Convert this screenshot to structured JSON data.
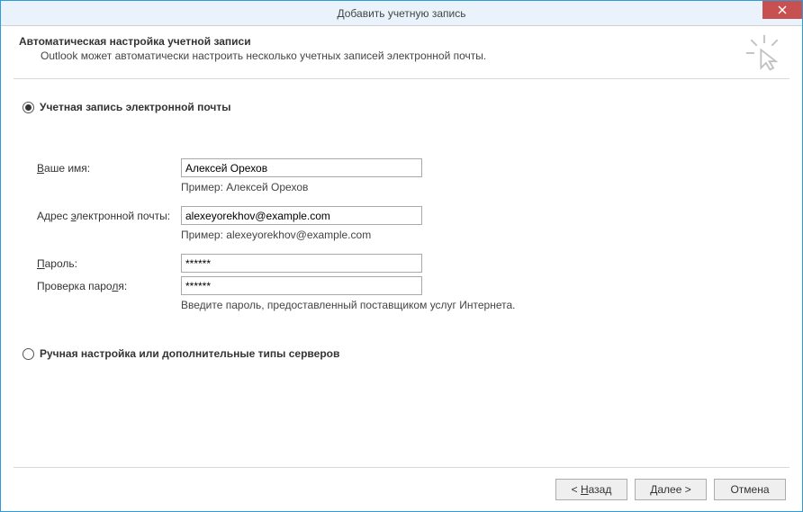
{
  "window": {
    "title": "Добавить учетную запись"
  },
  "header": {
    "title": "Автоматическая настройка учетной записи",
    "subtitle": "Outlook может автоматически настроить несколько учетных записей электронной почты."
  },
  "radios": {
    "email_account": "Учетная запись электронной почты",
    "manual_prefix": "Ручная ",
    "manual_hk": "н",
    "manual_suffix": "астройка или дополнительные типы серверов"
  },
  "form": {
    "name_label_hk": "В",
    "name_label_suffix": "аше имя:",
    "name_value": "Алексей Орехов",
    "name_hint": "Пример: Алексей Орехов",
    "email_label_prefix": "Адрес ",
    "email_label_hk": "э",
    "email_label_suffix": "лектронной почты:",
    "email_value": "alexeyorekhov@example.com",
    "email_hint": "Пример: alexeyorekhov@example.com",
    "password_label_hk": "П",
    "password_label_suffix": "ароль:",
    "password_value": "******",
    "confirm_label_prefix": "Проверка паро",
    "confirm_label_hk": "л",
    "confirm_label_suffix": "я:",
    "confirm_value": "******",
    "password_hint": "Введите пароль, предоставленный поставщиком услуг Интернета."
  },
  "buttons": {
    "back_prefix": "< ",
    "back_hk": "Н",
    "back_suffix": "азад",
    "next_hk": "Д",
    "next_suffix": "алее >",
    "cancel": "Отмена"
  }
}
